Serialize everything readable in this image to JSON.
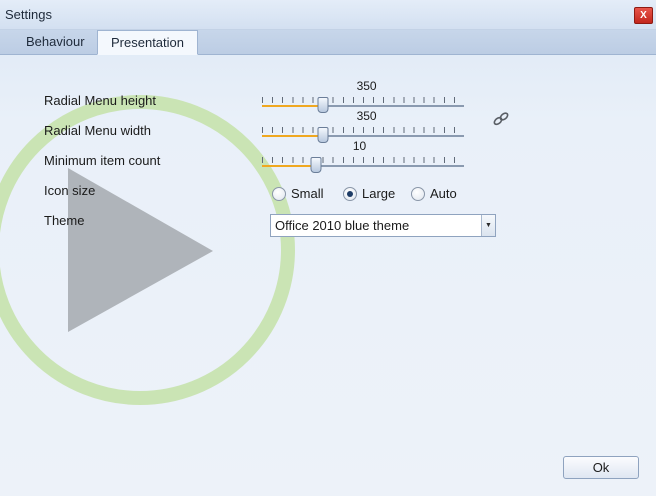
{
  "window": {
    "title": "Settings",
    "close_label": "X"
  },
  "tabs": [
    {
      "label": "Behaviour",
      "selected": false
    },
    {
      "label": "Presentation",
      "selected": true
    }
  ],
  "settings": {
    "radial_height": {
      "label": "Radial Menu height",
      "value": "350",
      "fraction": 0.3
    },
    "radial_width": {
      "label": "Radial Menu width",
      "value": "350",
      "fraction": 0.3
    },
    "min_items": {
      "label": "Minimum item count",
      "value": "10",
      "fraction": 0.265
    },
    "icon_size": {
      "label": "Icon size",
      "options": [
        "Small",
        "Large",
        "Auto"
      ],
      "selected": "Large"
    },
    "theme": {
      "label": "Theme",
      "value": "Office 2010 blue theme"
    }
  },
  "buttons": {
    "ok_label": "Ok"
  },
  "icons": {
    "link": "link-chain-icon",
    "dropdown": "chevron-down-icon",
    "watermark": "play-icon"
  },
  "colors": {
    "slider_fill": "#f0a820",
    "close": "#c2261c",
    "watermark_ring": "#b8dc98"
  }
}
